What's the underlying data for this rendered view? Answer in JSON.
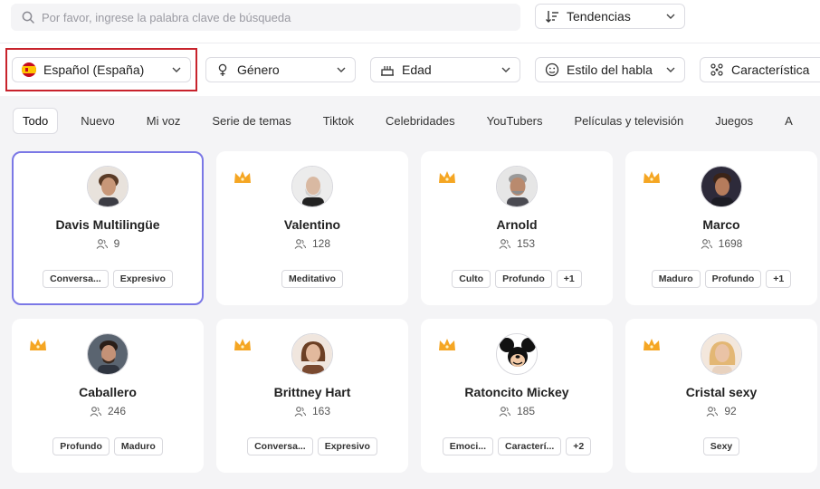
{
  "search": {
    "placeholder": "Por favor, ingrese la palabra clave de búsqueda"
  },
  "sort": {
    "label": "Tendencias"
  },
  "filters": [
    {
      "label": "Español (España)",
      "icon": "spain-flag-icon"
    },
    {
      "label": "Género",
      "icon": "gender-icon"
    },
    {
      "label": "Edad",
      "icon": "cake-icon"
    },
    {
      "label": "Estilo del habla",
      "icon": "smiley-icon"
    },
    {
      "label": "Característica",
      "icon": "sparkles-icon"
    }
  ],
  "tabs": [
    "Todo",
    "Nuevo",
    "Mi voz",
    "Serie de temas",
    "Tiktok",
    "Celebridades",
    "YouTubers",
    "Películas y televisión",
    "Juegos",
    "A"
  ],
  "active_tab": "Todo",
  "cards": [
    {
      "name": "Davis Multilingüe",
      "likes": "9",
      "tags": [
        "Conversa...",
        "Expresivo"
      ],
      "crown": false,
      "selected": true
    },
    {
      "name": "Valentino",
      "likes": "128",
      "tags": [
        "Meditativo"
      ],
      "crown": true
    },
    {
      "name": "Arnold",
      "likes": "153",
      "tags": [
        "Culto",
        "Profundo",
        "+1"
      ],
      "crown": true
    },
    {
      "name": "Marco",
      "likes": "1698",
      "tags": [
        "Maduro",
        "Profundo",
        "+1"
      ],
      "crown": true
    },
    {
      "name": "Caballero",
      "likes": "246",
      "tags": [
        "Profundo",
        "Maduro"
      ],
      "crown": true
    },
    {
      "name": "Brittney Hart",
      "likes": "163",
      "tags": [
        "Conversa...",
        "Expresivo"
      ],
      "crown": true
    },
    {
      "name": "Ratoncito Mickey",
      "likes": "185",
      "tags": [
        "Emoci...",
        "Caracterí...",
        "+2"
      ],
      "crown": true
    },
    {
      "name": "Cristal sexy",
      "likes": "92",
      "tags": [
        "Sexy"
      ],
      "crown": true
    }
  ],
  "colors": {
    "selected_border": "#7b78e6",
    "highlight": "#c8232c",
    "crown": "#f5a623"
  }
}
